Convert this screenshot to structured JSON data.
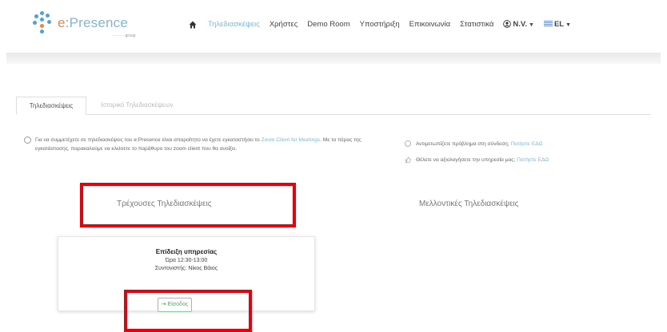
{
  "navbar": {
    "logo_text_prefix": "e:",
    "logo_text": "Presence",
    "logo_sub": "··········group",
    "items": [
      {
        "label": "Τηλεδιασκέψεις",
        "active": true
      },
      {
        "label": "Χρήστες"
      },
      {
        "label": "Demo Room"
      },
      {
        "label": "Υποστήριξη"
      },
      {
        "label": "Επικοινωνία"
      },
      {
        "label": "Στατιστικά"
      }
    ],
    "user_label": "N.V.",
    "lang_label": "EL"
  },
  "tabs": [
    {
      "label": "Τηλεδιασκέψεις",
      "active": true
    },
    {
      "label": "Ιστορικό Τηλεδιασκέψεων",
      "active": false
    }
  ],
  "info_left": {
    "text_1": "Για να συμμετέχετε σε τηλεδιασκέψεις του e:Presence είναι απαραίτητο να έχετε εγκαταστήσει το ",
    "link": "Zoom Client for Meetings",
    "text_2": ". Με το πέρας της εγκατάστασης, παρακαλούμε να κλείσετε το παράθυρο του zoom client που θα ανοίξει."
  },
  "info_right": {
    "problem_text": "Αντιμετωπίζετε πρόβλημα στη σύνδεση;",
    "problem_link": "Πατήστε ΕΔΩ",
    "rate_text": "Θέλετε να αξιολογήσετε την υπηρεσία μας;",
    "rate_link": "Πατήστε ΕΔΩ"
  },
  "sections": {
    "current_title": "Τρέχουσες Τηλεδιασκέψεις",
    "upcoming_title": "Μελλοντικές Τηλεδιασκέψεις"
  },
  "meeting_card": {
    "title": "Επίδειξη υπηρεσίας",
    "time": "Ώρα 12:30-13:00",
    "coordinator": "Συντονιστής: Νίκος Βάιος",
    "join_label": "Είσοδος"
  },
  "colors": {
    "accent": "#7ab8e4",
    "highlight": "#e8000b",
    "join_green": "#5aa868"
  }
}
